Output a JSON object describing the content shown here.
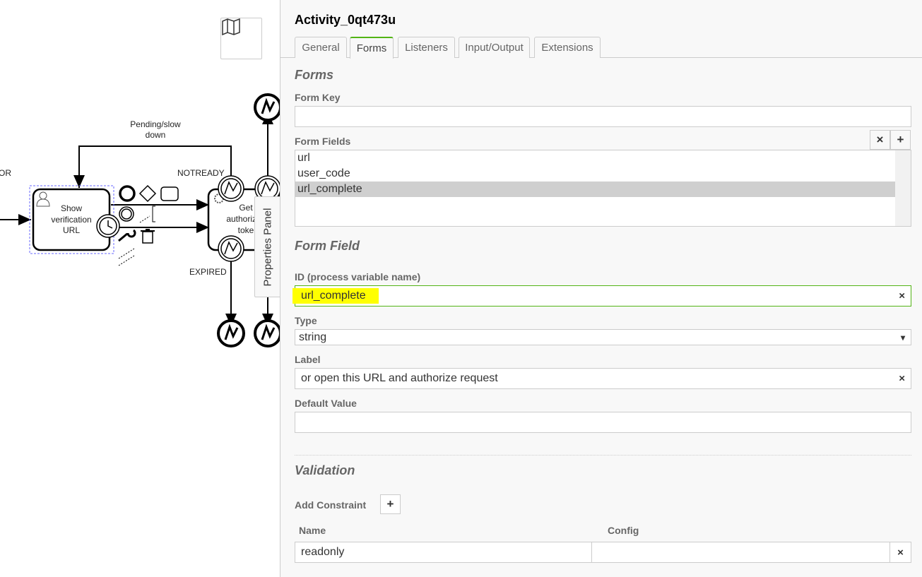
{
  "diagram": {
    "labels": {
      "pending": [
        "Pending/slow",
        "down"
      ],
      "error_partial": "OR",
      "notready": "NOTREADY",
      "expired": "EXPIRED"
    },
    "task1": [
      "Show",
      "verification",
      "URL"
    ],
    "task2": [
      "Get",
      "authoriza",
      "toke"
    ]
  },
  "canvas": {
    "map_icon": "map-icon",
    "properties_panel_toggle": "Properties Panel"
  },
  "panel": {
    "title": "Activity_0qt473u",
    "tabs": [
      {
        "label": "General"
      },
      {
        "label": "Forms",
        "active": true
      },
      {
        "label": "Listeners"
      },
      {
        "label": "Input/Output"
      },
      {
        "label": "Extensions"
      }
    ],
    "forms_heading": "Forms",
    "form_key_label": "Form Key",
    "form_key_value": "",
    "form_fields_label": "Form Fields",
    "form_fields": [
      "url",
      "user_code",
      "url_complete"
    ],
    "selected_field": "url_complete",
    "form_field_heading": "Form Field",
    "id_label": "ID (process variable name)",
    "id_value": "url_complete",
    "type_label": "Type",
    "type_value": "string",
    "label_label": "Label",
    "label_value": "or open this URL and authorize request",
    "default_label": "Default Value",
    "default_value": "",
    "validation_heading": "Validation",
    "add_constraint_label": "Add Constraint",
    "constraints_headers": [
      "Name",
      "Config"
    ],
    "constraints": [
      {
        "name": "readonly",
        "config": ""
      }
    ],
    "clear_symbol": "×",
    "add_symbol": "+",
    "dropdown_symbol": "▾",
    "accent": "#52b415",
    "highlight": "#ffff00"
  }
}
